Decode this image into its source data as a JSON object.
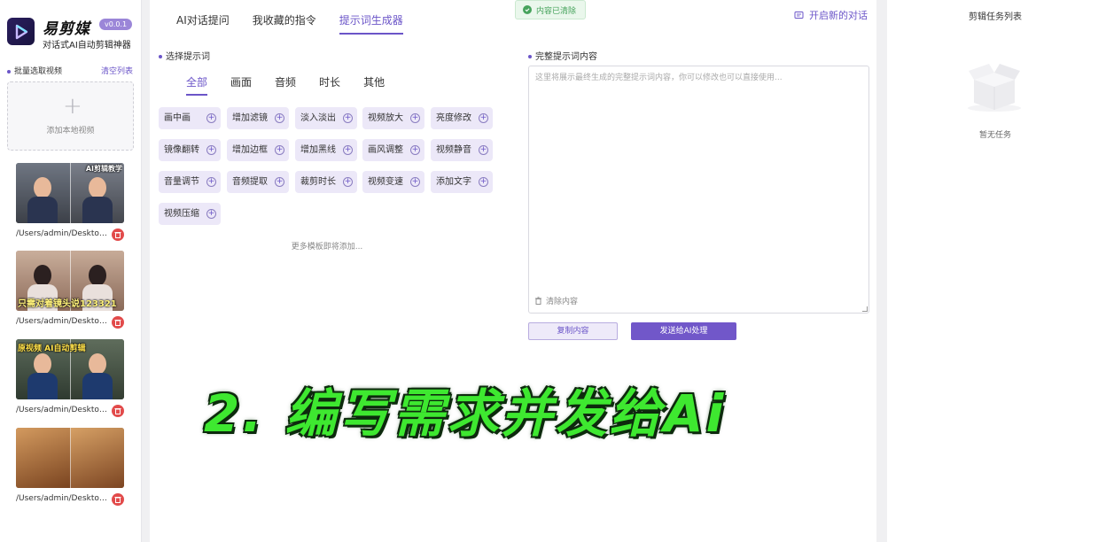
{
  "app": {
    "name": "易剪媒",
    "version": "v0.0.1",
    "subtitle": "对话式AI自动剪辑神器"
  },
  "sidebar": {
    "batch_label": "批量选取视频",
    "clear_list": "清空列表",
    "add_local": "添加本地视频",
    "videos": [
      {
        "path": "/Users/admin/Desktop/...",
        "caption": "AI剪辑教学",
        "theme": "office"
      },
      {
        "path": "/Users/admin/Desktop/...",
        "caption": "只需对着镜头说123321",
        "theme": "studio"
      },
      {
        "path": "/Users/admin/Desktop/...",
        "caption": "原视频   AI自动剪辑",
        "theme": "store"
      },
      {
        "path": "/Users/admin/Desktop/...",
        "caption": "",
        "theme": "food"
      }
    ]
  },
  "header": {
    "tabs": [
      {
        "label": "AI对话提问",
        "active": false
      },
      {
        "label": "我收藏的指令",
        "active": false
      },
      {
        "label": "提示词生成器",
        "active": true
      }
    ],
    "toast": "内容已清除",
    "new_chat": "开启新的对话"
  },
  "prompt_selector": {
    "title": "选择提示词",
    "categories": [
      {
        "label": "全部",
        "active": true
      },
      {
        "label": "画面",
        "active": false
      },
      {
        "label": "音频",
        "active": false
      },
      {
        "label": "时长",
        "active": false
      },
      {
        "label": "其他",
        "active": false
      }
    ],
    "chips": [
      "画中画",
      "增加滤镜",
      "淡入淡出",
      "视频放大",
      "亮度修改",
      "镜像翻转",
      "增加边框",
      "增加黑线",
      "画风调整",
      "视频静音",
      "音量调节",
      "音频提取",
      "裁剪时长",
      "视频变速",
      "添加文字",
      "视频压缩"
    ],
    "more_text": "更多模板即将添加..."
  },
  "prompt_content": {
    "title": "完整提示词内容",
    "placeholder": "这里将展示最终生成的完整提示词内容，你可以修改也可以直接使用...",
    "clear_label": "清除内容",
    "copy_label": "复制内容",
    "send_label": "发送给AI处理"
  },
  "task_panel": {
    "title": "剪辑任务列表",
    "empty_text": "暂无任务"
  },
  "overlay": {
    "caption": "2. 编写需求并发给Ai"
  },
  "colors": {
    "accent": "#6b55c8",
    "chip_bg": "#ece8f8",
    "caption_green": "#3ee830",
    "delete_red": "#e24b4b",
    "toast_green": "#47a35c"
  }
}
